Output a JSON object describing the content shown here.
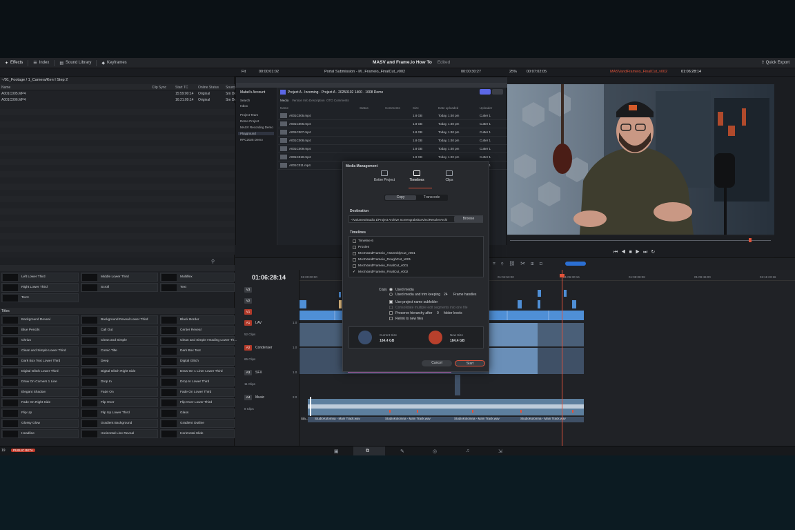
{
  "menubar": {
    "effects": "Effects",
    "index": "Index",
    "sound_library": "Sound Library",
    "keyframes": "Keyframes",
    "title": "MASV and Frame.io How To",
    "status": "Edited",
    "quick_export": "Quick Export"
  },
  "toolbar2": {
    "fit": "Fit",
    "timecode_left": "00:00:01:02",
    "clip_name": "Portal Submission - M...Frameio_FinalCut_v002",
    "duration": "00:00:30:27",
    "zoom": "25%",
    "timecode_mid": "00:07:02:05",
    "timeline_name": "MASVandFrameio_FinalCut_v002",
    "timecode_right": "01:06:28:14"
  },
  "media_pool": {
    "path": "~/01_Footage / 1_Camera/Ken I Step 2",
    "columns": [
      "Name",
      "Clip Sync",
      "Start TC",
      "Online Status",
      "Source"
    ],
    "rows": [
      {
        "name": "A001C005.MP4",
        "start": "15:59:00:14",
        "status": "Original",
        "src": "Sm Do"
      },
      {
        "name": "A001C006.MP4",
        "start": "16:21:09:14",
        "status": "Original",
        "src": "Sm Do"
      }
    ]
  },
  "browser": {
    "sidebar": [
      "Search",
      "Inbox",
      "Project Team",
      "Demo Project",
      "MASV Recording Demo",
      "Playground",
      "RPC2025 Demo"
    ],
    "account": "Mabel's Account",
    "project_title": "Project A · Incoming · Project A · 20250102 1400 · 1008 Demo",
    "tabs": [
      "Media",
      "Version Info",
      "Description",
      "OTO Comments"
    ],
    "columns": [
      "Name",
      "Status",
      "Comments",
      "Size",
      "Date uploaded",
      "Uploader"
    ],
    "rows": [
      {
        "name": "A001C005.mp4",
        "size": "1.8 GB",
        "date": "Today, 1:40 pm",
        "up": "Cutter 1"
      },
      {
        "name": "A001C006.mp4",
        "size": "1.8 GB",
        "date": "Today, 1:40 pm",
        "up": "Cutter 1"
      },
      {
        "name": "A001C007.mp4",
        "size": "1.8 GB",
        "date": "Today, 1:40 pm",
        "up": "Cutter 1"
      },
      {
        "name": "A001C008.mp4",
        "size": "1.8 GB",
        "date": "Today, 1:40 pm",
        "up": "Cutter 1"
      },
      {
        "name": "A001C009.mp4",
        "size": "1.8 GB",
        "date": "Today, 1:40 pm",
        "up": "Cutter 1"
      },
      {
        "name": "A001C010.mp4",
        "size": "1.8 GB",
        "date": "Today, 1:40 pm",
        "up": "Cutter 1"
      },
      {
        "name": "A001C011.mp4",
        "size": "1.8 GB",
        "date": "Today, 1:40 pm",
        "up": "Cutter 1"
      }
    ]
  },
  "dialog": {
    "title": "Media Management",
    "tabs": [
      "Entire Project",
      "Timelines",
      "Clips"
    ],
    "modes": [
      "Copy",
      "Transcode"
    ],
    "destination_label": "Destination",
    "destination_path": "~/Volumes/Studio 1/Project Archive Screengrabs/DaVinciResolveArchive",
    "browse": "Browse",
    "timelines_label": "Timelines",
    "timelines": [
      {
        "name": "Timeline 6",
        "checked": false
      },
      {
        "name": "Proxies",
        "checked": false
      },
      {
        "name": "MASVandFrameio_AssemblyCut_v001",
        "checked": false
      },
      {
        "name": "MASVandFrameio_RoughCut_v001",
        "checked": false
      },
      {
        "name": "MASVandFrameio_FinalCut_v001",
        "checked": false
      },
      {
        "name": "MASVandFrameio_FinalCut_v002",
        "checked": true
      }
    ],
    "copy_label": "Copy",
    "copy_opt1": "Used media",
    "copy_opt2": "Used media and trim keeping",
    "frames_value": "24",
    "frames_label": "Frame handles",
    "opt_subfolder": "Use project name subfolder",
    "opt_consolidate": "Consolidate multiple edit segments into one file",
    "opt_preserve": "Preserve hierarchy after",
    "preserve_value": "0",
    "preserve_label": "folder levels",
    "opt_relink": "Relink to new files",
    "current_size_label": "Current Size",
    "current_size": "184.4 GB",
    "new_size_label": "New Size",
    "new_size": "184.4 GB",
    "cancel": "Cancel",
    "start": "Start"
  },
  "timeline": {
    "timecode": "01:06:28:14",
    "ruler": [
      "01:00:00:00",
      "01:01:37:16",
      "01:03:15:08",
      "01:04:53:00",
      "01:06:30:16",
      "01:08:08:08",
      "01:09:46:00",
      "01:11:23:16"
    ],
    "tracks": [
      {
        "tag": "V3",
        "name": ""
      },
      {
        "tag": "V2",
        "name": ""
      },
      {
        "tag": "V1",
        "name": ""
      },
      {
        "tag": "A1",
        "name": "LAV",
        "count": "52 Clips",
        "level": "1.0"
      },
      {
        "tag": "A2",
        "name": "Condenser",
        "count": "65 Clips",
        "level": "1.0"
      },
      {
        "tag": "A3",
        "name": "SFX",
        "count": "11 Clips",
        "level": "1.0"
      },
      {
        "tag": "A4",
        "name": "Music",
        "count": "8 Clips",
        "level": "2.0"
      }
    ],
    "music_clips": [
      "Sta...",
      "StudioKolomna - Main Track.wav",
      "StudioKolomna - Main Track.wav",
      "StudioKolomna - Main Track.wav",
      "StudioKolomna - Main Track.wav"
    ]
  },
  "effects": {
    "generators": [
      [
        "Left Lower Third",
        "Middle Lower Third",
        "Multiflex"
      ],
      [
        "Right Lower Third",
        "Scroll",
        "Text"
      ],
      [
        "Text+",
        "",
        ""
      ]
    ],
    "titles_label": "Titles",
    "titles": [
      [
        "Background Reveal",
        "Background Reveal Lower Third",
        "Black Border"
      ],
      [
        "Blue Pencils",
        "Call Out",
        "Center Reveal"
      ],
      [
        "Chrius",
        "Clean and Simple",
        "Clean and Simple Heading Lower Th..."
      ],
      [
        "Clean and Simple Lower Third",
        "Comic Title",
        "Dark Box Text"
      ],
      [
        "Dark Box Text Lower Third",
        "Deep",
        "Digital Glitch"
      ],
      [
        "Digital Glitch Lower Third",
        "Digital Glitch Right Side",
        "Draw On 1 Liner Lower Third"
      ],
      [
        "Draw On Corners 1 Line",
        "Drop In",
        "Drop In Lower Third"
      ],
      [
        "Elegant Shadow",
        "Fade On",
        "Fade On Lower Third"
      ],
      [
        "Fade On Right Side",
        "Flip Over",
        "Flip Over Lower Third"
      ],
      [
        "Flip Up",
        "Flip Up Lower Third",
        "Glass"
      ],
      [
        "Glossy Glow",
        "Gradient Background",
        "Gradient Outline"
      ],
      [
        "Headline",
        "Horizontal Line Reveal",
        "Horizontal Slide"
      ]
    ]
  },
  "status": {
    "version": "19",
    "badge": "PUBLIC BETA"
  },
  "colors": {
    "accent": "#e2533a",
    "video_clip": "#4f8fd6",
    "audio_clip": "#4a7fb0",
    "music_clip": "#5d7f9e",
    "pink_clip": "#d57ad1"
  }
}
